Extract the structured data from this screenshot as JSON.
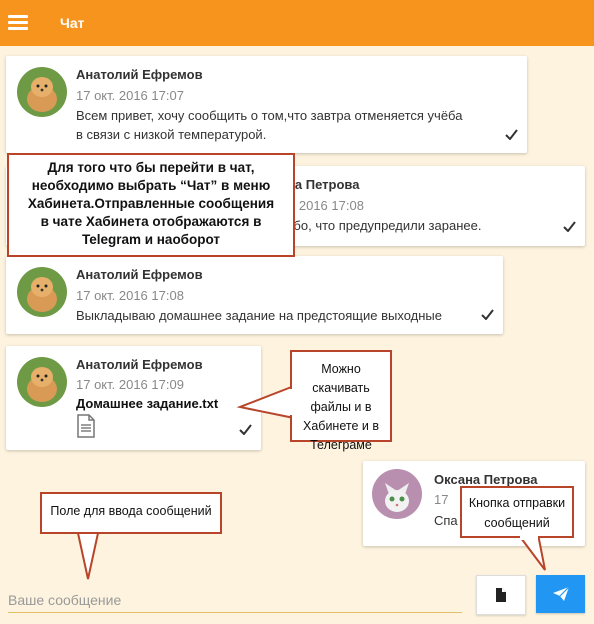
{
  "app": {
    "title": "Чат"
  },
  "messages": [
    {
      "author": "Анатолий Ефремов",
      "time": "17 окт. 2016 17:07",
      "text": "Всем привет, хочу сообщить о том,что завтра отменяется учёба",
      "text2": "в связи с  низкой температурой."
    },
    {
      "author": "Оксана Петрова",
      "time": "17 окт. 2016 17:08",
      "text": "Спасибо, что предупредили заранее."
    },
    {
      "author": "Анатолий Ефремов",
      "time": "17 окт. 2016 17:08",
      "text": "Выкладываю домашнее задание на предстоящие выходные"
    },
    {
      "author": "Анатолий Ефремов",
      "time": "17 окт. 2016 17:09",
      "file": "Домашнее задание.txt"
    },
    {
      "author": "Оксана Петрова",
      "time": "17",
      "text": "Спа"
    }
  ],
  "callouts": {
    "main": [
      "Для того что бы перейти в чат,",
      "необходимо выбрать “Чат”  в меню",
      "Хабинета.Отправленные сообщения",
      "в чате Хабинета отображаются в",
      "Telegram и наоборот"
    ],
    "files": [
      "Можно скачивать",
      "файлы и в",
      "Хабинете и в",
      "Телеграме"
    ],
    "input": "Поле для ввода сообщений",
    "send": [
      "Кнопка отправки",
      "сообщений"
    ]
  },
  "input": {
    "placeholder": "Ваше сообщение"
  },
  "colors": {
    "header": "#f7941d",
    "send": "#2196f3",
    "callout_border": "#b8452a"
  },
  "icons": {
    "menu": "hamburger-icon",
    "check": "check-icon",
    "file": "file-icon",
    "send": "paper-plane-icon"
  }
}
